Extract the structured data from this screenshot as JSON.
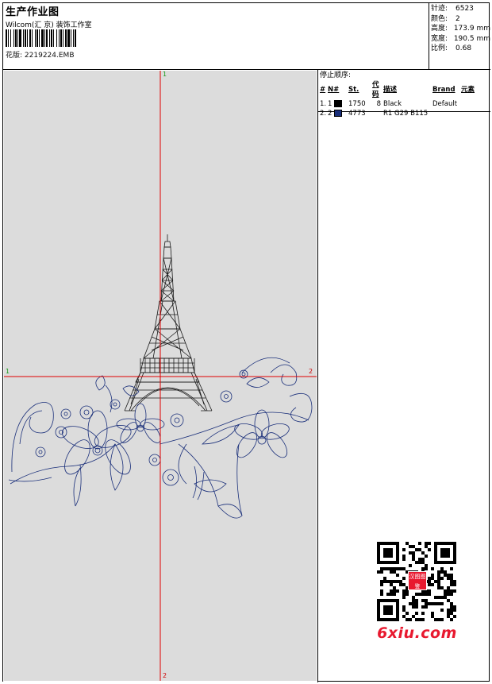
{
  "header": {
    "title": "生产作业图",
    "subtitle": "Wilcom(汇 京) 装饰工作室",
    "design_label": "花版:",
    "design_file": "2219224.EMB"
  },
  "stats": [
    {
      "label": "针迹:",
      "value": "6523"
    },
    {
      "label": "颜色:",
      "value": "2"
    },
    {
      "label": "高度:",
      "value": "173.9 mm"
    },
    {
      "label": "宽度:",
      "value": "190.5 mm"
    },
    {
      "label": "比例:",
      "value": "0.68"
    }
  ],
  "colors": {
    "title": "停止顺序:",
    "headers": [
      "#",
      "N#",
      "St.",
      "代码",
      "描述",
      "Brand",
      "元素"
    ],
    "rows": [
      {
        "index": "1.",
        "n": "1",
        "swatch": "#000000",
        "stitches": "1750",
        "code": "8",
        "description": "Black",
        "brand": "Default",
        "element": ""
      },
      {
        "index": "2.",
        "n": "2",
        "swatch": "#1a2f7a",
        "stitches": "4773",
        "code": "",
        "description": "R1 G29 B115",
        "brand": "",
        "element": ""
      }
    ]
  },
  "axes": {
    "top_label": "1",
    "bottom_label": "2",
    "left_label": "1",
    "right_label": "2"
  },
  "watermark": {
    "stamp_text": "汉图图鉴",
    "site": "6xiu.com"
  }
}
